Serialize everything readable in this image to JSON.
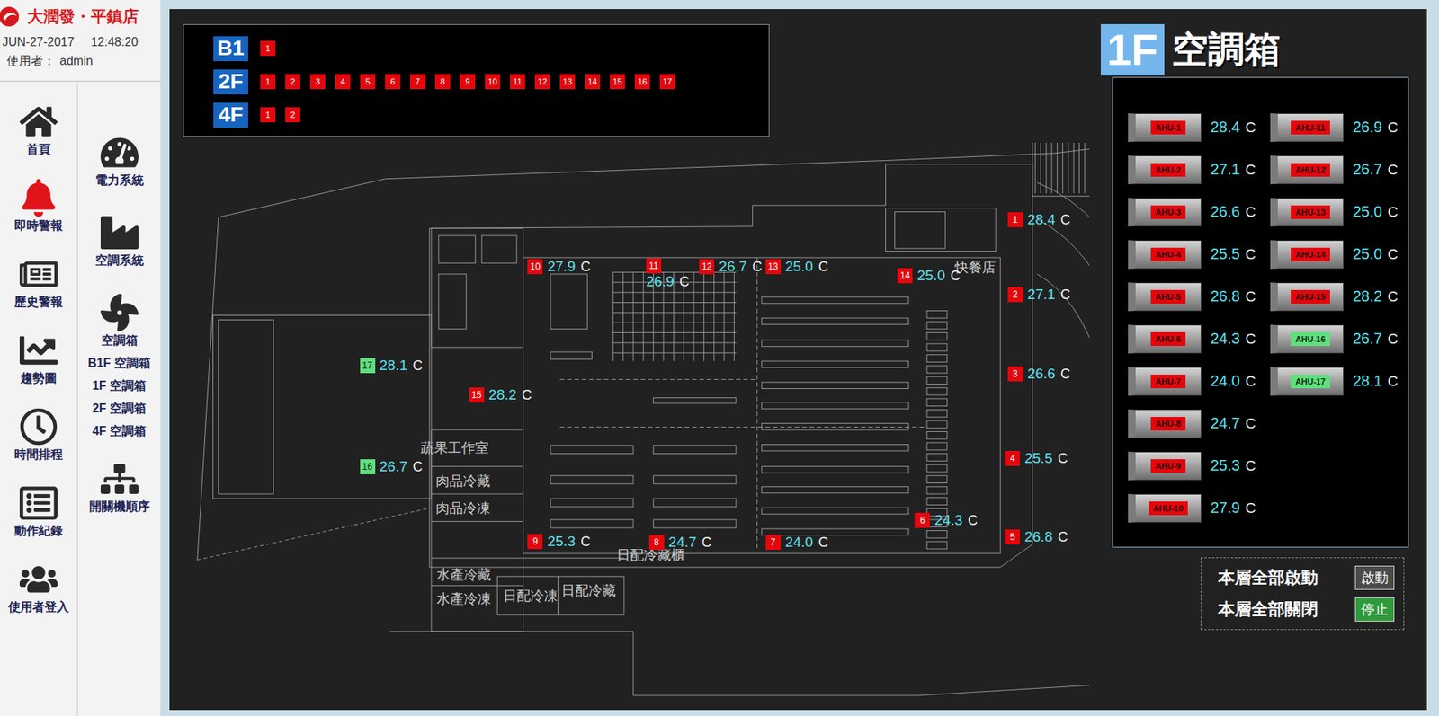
{
  "sidebar": {
    "brand": "大潤發・平鎮店",
    "date": "JUN-27-2017",
    "time": "12:48:20",
    "user_label": "使用者：",
    "user": "admin",
    "nav_left": [
      {
        "label": "首頁",
        "alert": false
      },
      {
        "label": "即時警報",
        "alert": true
      },
      {
        "label": "歷史警報",
        "alert": false
      },
      {
        "label": "趨勢圖",
        "alert": false
      },
      {
        "label": "時間排程",
        "alert": false
      },
      {
        "label": "動作紀錄",
        "alert": false
      },
      {
        "label": "使用者登入",
        "alert": false
      }
    ],
    "nav_right": [
      {
        "label": "電力系統",
        "kind": "icon"
      },
      {
        "label": "空調系統",
        "kind": "icon"
      },
      {
        "label": "空調箱",
        "kind": "icon"
      },
      {
        "label": "B1F 空調箱",
        "kind": "text"
      },
      {
        "label": "1F 空調箱",
        "kind": "text"
      },
      {
        "label": "2F 空調箱",
        "kind": "text"
      },
      {
        "label": "4F 空調箱",
        "kind": "text"
      },
      {
        "label": "開關機順序",
        "kind": "icon"
      }
    ]
  },
  "floor_selector": [
    {
      "floor": "B1",
      "units": [
        "1"
      ]
    },
    {
      "floor": "2F",
      "units": [
        "1",
        "2",
        "3",
        "4",
        "5",
        "6",
        "7",
        "8",
        "9",
        "10",
        "11",
        "12",
        "13",
        "14",
        "15",
        "16",
        "17"
      ]
    },
    {
      "floor": "4F",
      "units": [
        "1",
        "2"
      ]
    }
  ],
  "title": {
    "floor": "1F",
    "name": "空調箱"
  },
  "ahu_list": [
    {
      "label": "AHU-1",
      "number": "1",
      "temp": "28.4",
      "unit": "C",
      "running": false
    },
    {
      "label": "AHU-2",
      "number": "2",
      "temp": "27.1",
      "unit": "C",
      "running": false
    },
    {
      "label": "AHU-3",
      "number": "3",
      "temp": "26.6",
      "unit": "C",
      "running": false
    },
    {
      "label": "AHU-4",
      "number": "4",
      "temp": "25.5",
      "unit": "C",
      "running": false
    },
    {
      "label": "AHU-5",
      "number": "5",
      "temp": "26.8",
      "unit": "C",
      "running": false
    },
    {
      "label": "AHU-6",
      "number": "6",
      "temp": "24.3",
      "unit": "C",
      "running": false
    },
    {
      "label": "AHU-7",
      "number": "7",
      "temp": "24.0",
      "unit": "C",
      "running": false
    },
    {
      "label": "AHU-8",
      "number": "8",
      "temp": "24.7",
      "unit": "C",
      "running": false
    },
    {
      "label": "AHU-9",
      "number": "9",
      "temp": "25.3",
      "unit": "C",
      "running": false
    },
    {
      "label": "AHU-10",
      "number": "10",
      "temp": "27.9",
      "unit": "C",
      "running": false
    },
    {
      "label": "AHU-11",
      "number": "11",
      "temp": "26.9",
      "unit": "C",
      "running": false
    },
    {
      "label": "AHU-12",
      "number": "12",
      "temp": "26.7",
      "unit": "C",
      "running": false
    },
    {
      "label": "AHU-13",
      "number": "13",
      "temp": "25.0",
      "unit": "C",
      "running": false
    },
    {
      "label": "AHU-14",
      "number": "14",
      "temp": "25.0",
      "unit": "C",
      "running": false
    },
    {
      "label": "AHU-15",
      "number": "15",
      "temp": "28.2",
      "unit": "C",
      "running": false
    },
    {
      "label": "AHU-16",
      "number": "16",
      "temp": "26.7",
      "unit": "C",
      "running": true
    },
    {
      "label": "AHU-17",
      "number": "17",
      "temp": "28.1",
      "unit": "C",
      "running": true
    }
  ],
  "map_labels": [
    "蔬果工作室",
    "肉品冷藏",
    "肉品冷凍",
    "日配冷藏櫃",
    "水產冷藏",
    "水產冷凍",
    "日配冷凍",
    "日配冷藏",
    "快餐店"
  ],
  "controls": [
    {
      "label": "本層全部啟動",
      "button": "啟動",
      "color": "#4a4a4a"
    },
    {
      "label": "本層全部關閉",
      "button": "停止",
      "color": "#2f9a3c"
    }
  ]
}
